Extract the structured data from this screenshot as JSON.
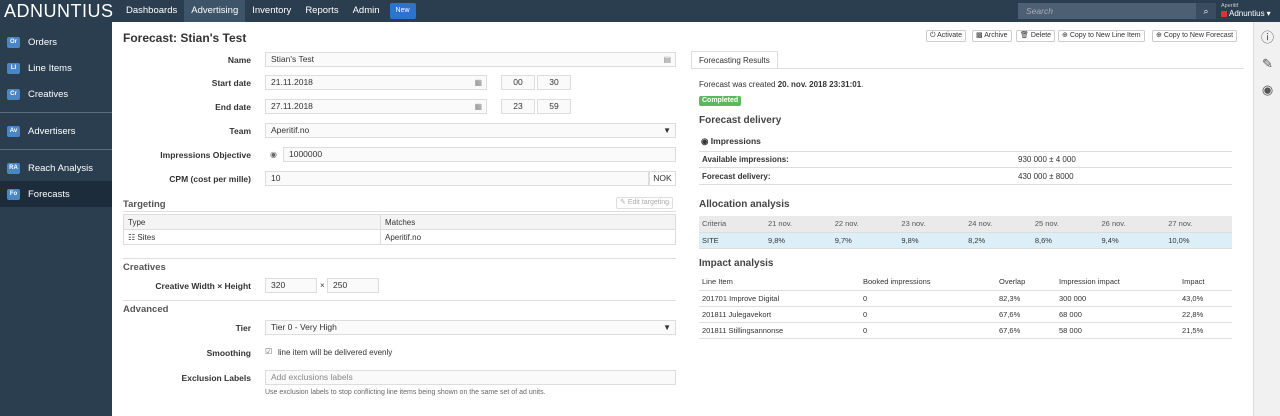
{
  "brand": "ADNUNTIUS",
  "nav": [
    "Dashboards",
    "Advertising",
    "Inventory",
    "Reports",
    "Admin"
  ],
  "nav_new": "New",
  "search_placeholder": "Search",
  "user": {
    "small": "Aperitif",
    "name": "Adnuntius"
  },
  "sidebar": [
    {
      "badge": "Or",
      "label": "Orders"
    },
    {
      "badge": "LI",
      "label": "Line Items"
    },
    {
      "badge": "Cr",
      "label": "Creatives"
    },
    {
      "badge": "Av",
      "label": "Advertisers"
    },
    {
      "badge": "RA",
      "label": "Reach Analysis"
    },
    {
      "badge": "Fo",
      "label": "Forecasts"
    }
  ],
  "title": "Forecast: Stian's Test",
  "actions": [
    "Activate",
    "Archive",
    "Delete",
    "Copy to New Line Item",
    "Copy to New Forecast"
  ],
  "form": {
    "name_label": "Name",
    "name": "Stian's Test",
    "start_label": "Start date",
    "start": "21.11.2018",
    "start_h": "00",
    "start_m": "30",
    "end_label": "End date",
    "end": "27.11.2018",
    "end_h": "23",
    "end_m": "59",
    "team_label": "Team",
    "team": "Aperitif.no",
    "imp_label": "Impressions Objective",
    "imp": "1000000",
    "cpm_label": "CPM (cost per mille)",
    "cpm": "10",
    "cpm_cur": "NOK"
  },
  "targeting": {
    "title": "Targeting",
    "edit": "Edit targeting",
    "col_type": "Type",
    "col_matches": "Matches",
    "row_type": "Sites",
    "row_match": "Aperitif.no"
  },
  "creatives": {
    "title": "Creatives",
    "wh_label": "Creative Width × Height",
    "w": "320",
    "x": "×",
    "h": "250"
  },
  "advanced": {
    "title": "Advanced",
    "tier_label": "Tier",
    "tier": "Tier 0 - Very High",
    "smooth_label": "Smoothing",
    "smooth": "line item will be delivered evenly",
    "excl_label": "Exclusion Labels",
    "excl_placeholder": "Add exclusions labels",
    "excl_help": "Use exclusion labels to stop conflicting line items being shown on the same set of ad units."
  },
  "results": {
    "tab": "Forecasting Results",
    "created_prefix": "Forecast was created ",
    "created_date": "20. nov. 2018 23:31:01",
    "created_suffix": ".",
    "status": "Completed",
    "delivery_title": "Forecast delivery",
    "radio": "Impressions",
    "avail_label": "Available impressions:",
    "avail": "930 000 ± 4 000",
    "deliv_label": "Forecast delivery:",
    "deliv": "430 000 ± 8000",
    "alloc_title": "Allocation analysis",
    "alloc_head": [
      "Criteria",
      "21 nov.",
      "22 nov.",
      "23 nov.",
      "24 nov.",
      "25 nov.",
      "26 nov.",
      "27 nov."
    ],
    "alloc_row": [
      "SITE",
      "9,8%",
      "9,7%",
      "9,8%",
      "8,2%",
      "8,6%",
      "9,4%",
      "10,0%"
    ],
    "impact_title": "Impact analysis",
    "impact_head": [
      "Line Item",
      "Booked impressions",
      "Overlap",
      "Impression impact",
      "Impact"
    ],
    "impact_rows": [
      [
        "201701 Improve Digital",
        "0",
        "82,3%",
        "300 000",
        "43,0%"
      ],
      [
        "201811 Julegavekort",
        "0",
        "67,6%",
        "68 000",
        "22,8%"
      ],
      [
        "201811 Stillingsannonse",
        "0",
        "67,6%",
        "58 000",
        "21,5%"
      ]
    ]
  }
}
